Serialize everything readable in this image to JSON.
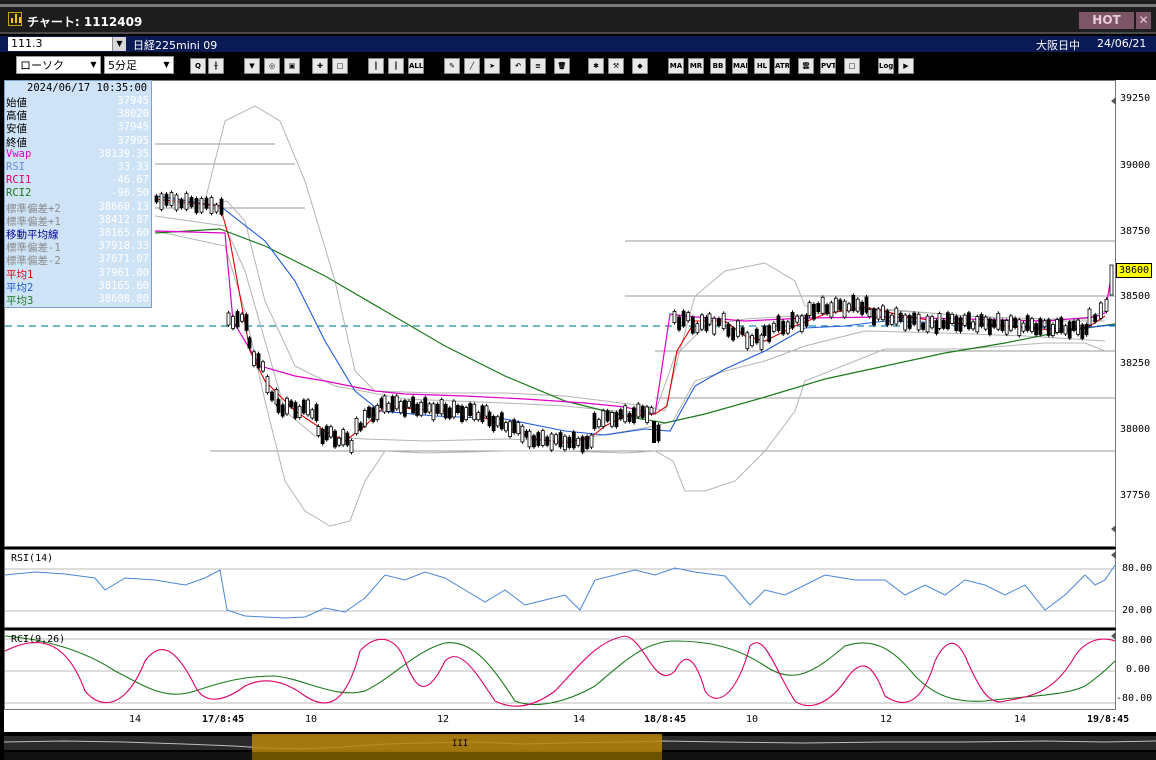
{
  "window": {
    "title": "チャート: 1112409",
    "hot_label": "HOT",
    "close_label": "✕"
  },
  "infobar": {
    "symbol_code": "111.3",
    "instrument": "日経225mini 09",
    "session": "大阪日中",
    "date": "24/06/21"
  },
  "toolbar": {
    "chart_type": "ローソク",
    "interval": "5分足",
    "buttons": [
      {
        "name": "zoom-icon",
        "text": "Q"
      },
      {
        "name": "crosshair-icon",
        "text": "╂"
      },
      {
        "name": "down-arrow-icon",
        "text": "▼"
      },
      {
        "name": "candle-zoom-icon",
        "text": "◎"
      },
      {
        "name": "multi-icon",
        "text": "▣"
      },
      {
        "name": "split-icon",
        "text": "✚"
      },
      {
        "name": "blank-icon",
        "text": "□"
      },
      {
        "name": "candle-icon",
        "text": "┃"
      },
      {
        "name": "candle-2-icon",
        "text": "┃"
      },
      {
        "name": "all-icon",
        "text": "ALL"
      },
      {
        "name": "pencil-icon",
        "text": "✎"
      },
      {
        "name": "line-icon",
        "text": "╱"
      },
      {
        "name": "cursor-icon",
        "text": "➤"
      },
      {
        "name": "undo-icon",
        "text": "↶"
      },
      {
        "name": "memo-icon",
        "text": "≡"
      },
      {
        "name": "trash-icon",
        "text": "🗑"
      },
      {
        "name": "settings-icon",
        "text": "✱"
      },
      {
        "name": "wrench-icon",
        "text": "⚒"
      },
      {
        "name": "palette-icon",
        "text": "◆"
      },
      {
        "name": "ma-icon",
        "text": "MA"
      },
      {
        "name": "mr-icon",
        "text": "MR"
      },
      {
        "name": "bb-icon",
        "text": "BB"
      },
      {
        "name": "mae-icon",
        "text": "MAE"
      },
      {
        "name": "hl-icon",
        "text": "HL"
      },
      {
        "name": "atr-icon",
        "text": "ATR"
      },
      {
        "name": "kumo-icon",
        "text": "雲"
      },
      {
        "name": "pvt-icon",
        "text": "PVT"
      },
      {
        "name": "box-icon",
        "text": "□"
      },
      {
        "name": "log-icon",
        "text": "Log"
      },
      {
        "name": "export-icon",
        "text": "▶"
      }
    ]
  },
  "data_window": {
    "timestamp": "2024/06/17  10:35:00",
    "rows": [
      {
        "label": "始値",
        "value": "37945",
        "color": "#000000"
      },
      {
        "label": "高値",
        "value": "38020",
        "color": "#000000"
      },
      {
        "label": "安値",
        "value": "37945",
        "color": "#000000"
      },
      {
        "label": "終値",
        "value": "37995",
        "color": "#000000"
      },
      {
        "label": "Vwap",
        "value": "38139.35",
        "color": "#e000c8"
      },
      {
        "label": "RSI",
        "value": "33.33",
        "color": "#6a8fd8"
      },
      {
        "label": "RCI1",
        "value": "-46.67",
        "color": "#e0006a"
      },
      {
        "label": "RCI2",
        "value": "-96.50",
        "color": "#1a7a1a"
      },
      {
        "label": "標準偏差+2",
        "value": "38660.13",
        "color": "#8a8a8a"
      },
      {
        "label": "標準偏差+1",
        "value": "38412.87",
        "color": "#8a8a8a"
      },
      {
        "label": "移動平均線",
        "value": "38165.60",
        "color": "#0000a0"
      },
      {
        "label": "標準偏差-1",
        "value": "37918.33",
        "color": "#8a8a8a"
      },
      {
        "label": "標準偏差-2",
        "value": "37671.07",
        "color": "#8a8a8a"
      },
      {
        "label": "平均1",
        "value": "37961.00",
        "color": "#e00000"
      },
      {
        "label": "平均2",
        "value": "38165.60",
        "color": "#1e5adc"
      },
      {
        "label": "平均3",
        "value": "38608.80",
        "color": "#1a7a1a"
      }
    ]
  },
  "price_axis": {
    "labels": [
      "39250",
      "39000",
      "38750",
      "38500",
      "38250",
      "38000",
      "37750"
    ],
    "current_price": "38600"
  },
  "rsi": {
    "title": "RSI(14)",
    "labels": [
      "80.00",
      "20.00"
    ]
  },
  "rci": {
    "title": "RCI(9,26)",
    "labels": [
      "80.00",
      "0.00",
      "-80.00"
    ]
  },
  "time_axis": {
    "labels": [
      "14",
      "17/8:45",
      "10",
      "12",
      "14",
      "18/8:45",
      "10",
      "12",
      "14",
      "19/8:45"
    ]
  },
  "chart_data": {
    "type": "candlestick",
    "ylim": [
      37600,
      39300
    ],
    "sessions": [
      "17/8:45",
      "18/8:45",
      "19/8:45"
    ],
    "price_close_approx": [
      38850,
      38830,
      38820,
      38400,
      38100,
      38000,
      37980,
      38050,
      38100,
      38080,
      38050,
      38000,
      37980,
      38000,
      38060,
      38400,
      38420,
      38380,
      38350,
      38420,
      38460,
      38440,
      38420,
      38400,
      38390,
      38380,
      38370,
      38400,
      38600
    ],
    "ma_short": [
      38860,
      38760,
      38230,
      38050,
      37980,
      38020,
      38080,
      38060,
      38000,
      37980,
      38040,
      38300,
      38390,
      38410,
      38450,
      38440,
      38410,
      38390,
      38380,
      38400
    ],
    "vwap": [
      38400,
      38220,
      38130,
      38140,
      38150,
      38130,
      38110,
      38100,
      38100,
      38170,
      38400,
      38420,
      38420,
      38410,
      38400,
      38400
    ],
    "ma_long": [
      38770,
      38620,
      38470,
      38300,
      38150,
      38040,
      38080,
      38170,
      38260,
      38340,
      38380,
      38400
    ],
    "rsi_values": [
      75,
      72,
      55,
      30,
      25,
      22,
      40,
      60,
      70,
      55,
      30,
      45,
      65,
      55,
      60,
      70,
      60,
      50,
      30,
      45,
      60,
      55,
      70,
      80
    ]
  },
  "colors": {
    "up": "#ffffff",
    "down": "#000000",
    "ma_short": "#e00000",
    "ma_mid": "#1e5adc",
    "ma_long": "#1a7a1a",
    "vwap": "#e000c8",
    "band": "#b4b4b4",
    "rsi": "#4a86d8",
    "rci1": "#e0006a",
    "rci2": "#1a7a1a",
    "dash": "#1a8aa8"
  }
}
